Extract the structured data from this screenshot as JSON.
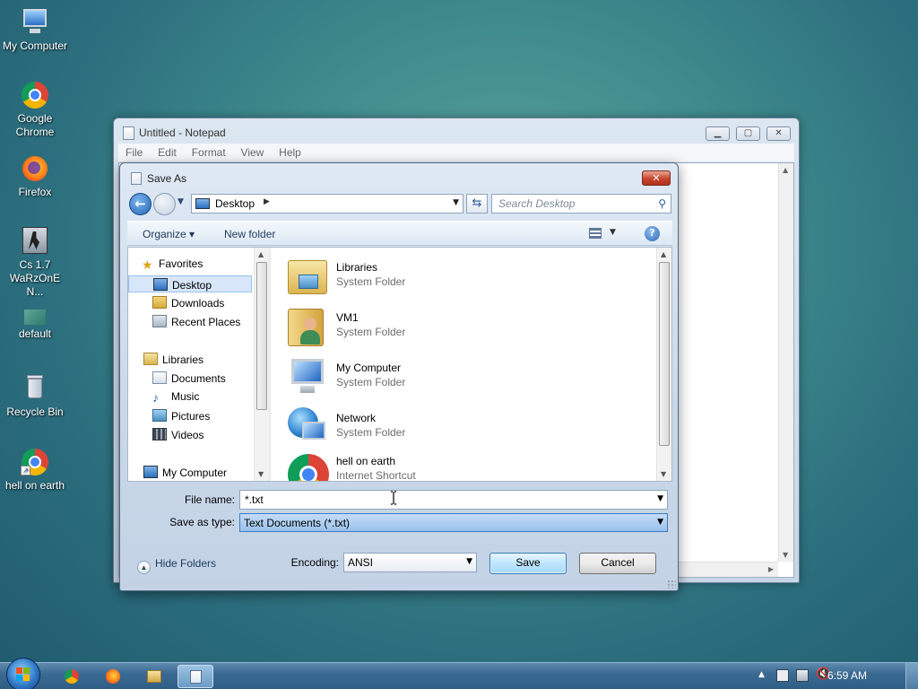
{
  "desktop": {
    "icons": [
      {
        "label": "My Computer",
        "icon": "computer-icon"
      },
      {
        "label": "Google Chrome",
        "icon": "chrome-icon"
      },
      {
        "label": "Firefox",
        "icon": "firefox-icon"
      },
      {
        "label": "Cs 1.7 WaRzOnE N...",
        "icon": "cs-game-icon"
      },
      {
        "label": "default",
        "icon": "image-file-icon"
      },
      {
        "label": "Recycle Bin",
        "icon": "recycle-bin-icon"
      },
      {
        "label": "hell on earth",
        "icon": "chrome-shortcut-icon"
      }
    ]
  },
  "notepad": {
    "title": "Untitled - Notepad",
    "menu": [
      "File",
      "Edit",
      "Format",
      "View",
      "Help"
    ]
  },
  "dialog": {
    "title": "Save As",
    "close_label": "✕",
    "address": "Desktop",
    "search_placeholder": "Search Desktop",
    "toolbar": {
      "organize": "Organize ▾",
      "new_folder": "New folder",
      "help": "?"
    },
    "nav": {
      "favorites": "Favorites",
      "favorites_items": [
        "Desktop",
        "Downloads",
        "Recent Places"
      ],
      "libraries": "Libraries",
      "libraries_items": [
        "Documents",
        "Music",
        "Pictures",
        "Videos"
      ],
      "computer": "My Computer",
      "selected": "Desktop"
    },
    "files": [
      {
        "name": "Libraries",
        "type": "System Folder",
        "icon": "libraries-icon"
      },
      {
        "name": "VM1",
        "type": "System Folder",
        "icon": "user-folder-icon"
      },
      {
        "name": "My Computer",
        "type": "System Folder",
        "icon": "computer-icon"
      },
      {
        "name": "Network",
        "type": "System Folder",
        "icon": "network-icon"
      },
      {
        "name": "hell on earth",
        "type": "Internet Shortcut",
        "icon": "chrome-icon"
      }
    ],
    "form": {
      "file_name_label": "File name:",
      "file_name_value": "*.txt",
      "save_type_label": "Save as type:",
      "save_type_value": "Text Documents (*.txt)",
      "hide_folders": "Hide Folders",
      "encoding_label": "Encoding:",
      "encoding_value": "ANSI",
      "save": "Save",
      "cancel": "Cancel"
    }
  },
  "taskbar": {
    "items": [
      "chrome-icon",
      "firefox-icon",
      "explorer-icon",
      "notepad-icon"
    ],
    "active": "notepad-icon",
    "clock": "6:59 AM"
  },
  "colors": {
    "accent": "#3d7bc4",
    "selection": "#d7e6f8",
    "desktop": "#3f8a8c"
  }
}
